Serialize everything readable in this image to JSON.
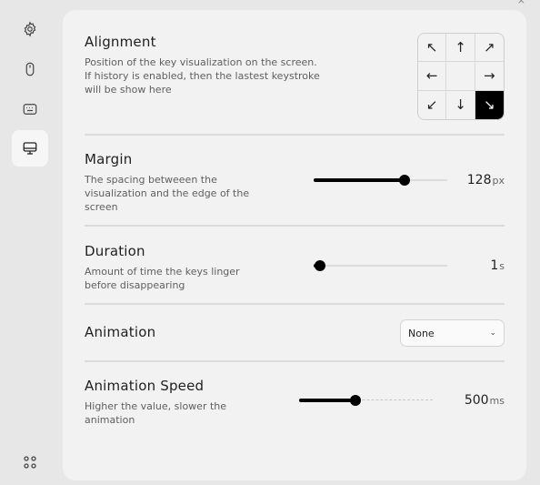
{
  "sidebar": {
    "items": [
      {
        "icon": "gear-icon"
      },
      {
        "icon": "mouse-icon"
      },
      {
        "icon": "keyboard-icon"
      },
      {
        "icon": "monitor-icon",
        "active": true
      }
    ],
    "bottom_icon": "apps-grid-icon"
  },
  "window": {
    "close_glyph": "×"
  },
  "alignment": {
    "title": "Alignment",
    "description_lines": [
      "Position of the key visualization on the screen.",
      "If history is enabled, then the lastest keystroke",
      "will be show here"
    ],
    "cells": [
      "↖",
      "↑",
      "↗",
      "←",
      "",
      "→",
      "↙",
      "↓",
      "↘"
    ],
    "selected": "bottom-right"
  },
  "margin": {
    "title": "Margin",
    "description_lines": [
      "The spacing betweeen the",
      "visualization and the edge of the",
      "screen"
    ],
    "value": "128",
    "unit": "px",
    "slider_fraction": 0.68
  },
  "duration": {
    "title": "Duration",
    "description_lines": [
      "Amount of time the keys linger",
      "before disappearing"
    ],
    "value": "1",
    "unit": "s",
    "slider_fraction": 0.05
  },
  "animation": {
    "title": "Animation",
    "selected": "None"
  },
  "animation_speed": {
    "title": "Animation Speed",
    "description_lines": [
      "Higher the value, slower the",
      "animation"
    ],
    "value": "500",
    "unit": "ms",
    "slider_fraction": 0.42
  }
}
